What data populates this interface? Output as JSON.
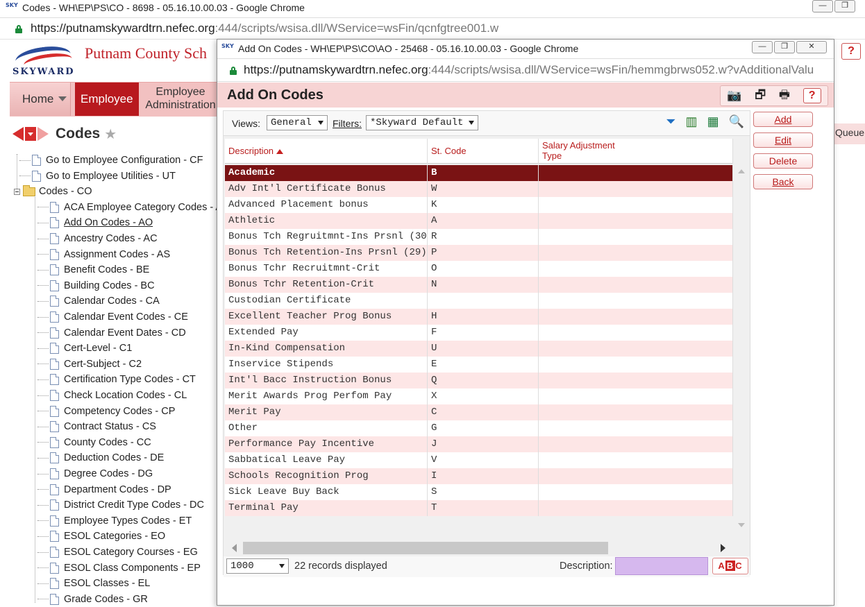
{
  "outer_window": {
    "title": "Codes - WH\\EP\\PS\\CO - 8698 - 05.16.10.00.03 - Google Chrome",
    "url_host": "https://putnamskywardtrn.nefec.org",
    "url_path": ":444/scripts/wsisa.dll/WService=wsFin/qcnfgtree001.w",
    "app_title": "Putnam County Sch",
    "logo_text": "SKYWARD",
    "nav": {
      "home": "Home",
      "employee": "Employee",
      "employee_admin": "Employee Administration"
    },
    "queue_label": "Queue",
    "help": "?"
  },
  "codes_panel": {
    "title": "Codes",
    "tree": [
      {
        "label": "Go to Employee Configuration - CF",
        "level": 1
      },
      {
        "label": "Go to Employee Utilities - UT",
        "level": 1
      },
      {
        "label": "Codes - CO",
        "level": 0,
        "folder": true
      },
      {
        "label": "ACA Employee Category Codes - A",
        "level": 2
      },
      {
        "label": "Add On Codes - AO",
        "level": 2,
        "active": true
      },
      {
        "label": "Ancestry Codes - AC",
        "level": 2
      },
      {
        "label": "Assignment Codes - AS",
        "level": 2
      },
      {
        "label": "Benefit Codes - BE",
        "level": 2
      },
      {
        "label": "Building Codes - BC",
        "level": 2
      },
      {
        "label": "Calendar Codes - CA",
        "level": 2
      },
      {
        "label": "Calendar Event Codes - CE",
        "level": 2
      },
      {
        "label": "Calendar Event Dates - CD",
        "level": 2
      },
      {
        "label": "Cert-Level - C1",
        "level": 2
      },
      {
        "label": "Cert-Subject - C2",
        "level": 2
      },
      {
        "label": "Certification Type Codes - CT",
        "level": 2
      },
      {
        "label": "Check Location Codes - CL",
        "level": 2
      },
      {
        "label": "Competency Codes - CP",
        "level": 2
      },
      {
        "label": "Contract Status - CS",
        "level": 2
      },
      {
        "label": "County Codes - CC",
        "level": 2
      },
      {
        "label": "Deduction Codes - DE",
        "level": 2
      },
      {
        "label": "Degree Codes - DG",
        "level": 2
      },
      {
        "label": "Department Codes - DP",
        "level": 2
      },
      {
        "label": "District Credit Type Codes - DC",
        "level": 2
      },
      {
        "label": "Employee Types Codes - ET",
        "level": 2
      },
      {
        "label": "ESOL Categories - EO",
        "level": 2
      },
      {
        "label": "ESOL Category Courses - EG",
        "level": 2
      },
      {
        "label": "ESOL Class Components - EP",
        "level": 2
      },
      {
        "label": "ESOL Classes - EL",
        "level": 2
      },
      {
        "label": "Grade Codes - GR",
        "level": 2
      }
    ]
  },
  "popup": {
    "title": "Add On Codes - WH\\EP\\PS\\CO\\AO - 25468 - 05.16.10.00.03 - Google Chrome",
    "url_host": "https://putnamskywardtrn.nefec.org",
    "url_path": ":444/scripts/wsisa.dll/WService=wsFin/hemmgbrws052.w?vAdditionalValu",
    "header_title": "Add On Codes",
    "help": "?",
    "views_label": "Views:",
    "views_value": "General",
    "filters_label": "Filters:",
    "filters_value": "*Skyward Default",
    "columns": [
      "Description",
      "St. Code",
      "Salary Adjustment Type"
    ],
    "rows": [
      {
        "desc": "Academic",
        "code": "B",
        "type": ""
      },
      {
        "desc": "Adv Int'l Certificate Bonus",
        "code": "W",
        "type": ""
      },
      {
        "desc": "Advanced Placement bonus",
        "code": "K",
        "type": ""
      },
      {
        "desc": "Athletic",
        "code": "A",
        "type": ""
      },
      {
        "desc": "Bonus Tch Regruitmnt-Ins Prsnl (30",
        "code": "R",
        "type": ""
      },
      {
        "desc": "Bonus Tch Retention-Ins Prsnl (29)",
        "code": "P",
        "type": ""
      },
      {
        "desc": "Bonus Tchr Recruitmnt-Crit",
        "code": "O",
        "type": ""
      },
      {
        "desc": "Bonus Tchr Retention-Crit",
        "code": "N",
        "type": ""
      },
      {
        "desc": "Custodian Certificate",
        "code": "",
        "type": ""
      },
      {
        "desc": "Excellent Teacher Prog Bonus",
        "code": "H",
        "type": ""
      },
      {
        "desc": "Extended Pay",
        "code": "F",
        "type": ""
      },
      {
        "desc": "In-Kind Compensation",
        "code": "U",
        "type": ""
      },
      {
        "desc": "Inservice Stipends",
        "code": "E",
        "type": ""
      },
      {
        "desc": "Int'l Bacc Instruction Bonus",
        "code": "Q",
        "type": ""
      },
      {
        "desc": "Merit Awards Prog Perfom Pay",
        "code": "X",
        "type": ""
      },
      {
        "desc": "Merit Pay",
        "code": "C",
        "type": ""
      },
      {
        "desc": "Other",
        "code": "G",
        "type": ""
      },
      {
        "desc": "Performance Pay Incentive",
        "code": "J",
        "type": ""
      },
      {
        "desc": "Sabbatical Leave Pay",
        "code": "V",
        "type": ""
      },
      {
        "desc": "Schools Recognition Prog",
        "code": "I",
        "type": ""
      },
      {
        "desc": "Sick Leave Buy Back",
        "code": "S",
        "type": ""
      },
      {
        "desc": "Terminal Pay",
        "code": "T",
        "type": ""
      }
    ],
    "selected_row": 0,
    "page_size": "1000",
    "records_text": "22 records displayed",
    "description_label": "Description:",
    "description_value": "",
    "abc_letters": [
      "A",
      "B",
      "C"
    ],
    "buttons": {
      "add": "Add",
      "edit": "Edit",
      "delete": "Delete",
      "back": "Back"
    }
  },
  "colors": {
    "brand_red": "#b8191e",
    "selected_row": "#7a1314",
    "alt_row": "#fde6e6",
    "header_pink": "#f7d4d4",
    "search_input": "#d6b8ee"
  }
}
